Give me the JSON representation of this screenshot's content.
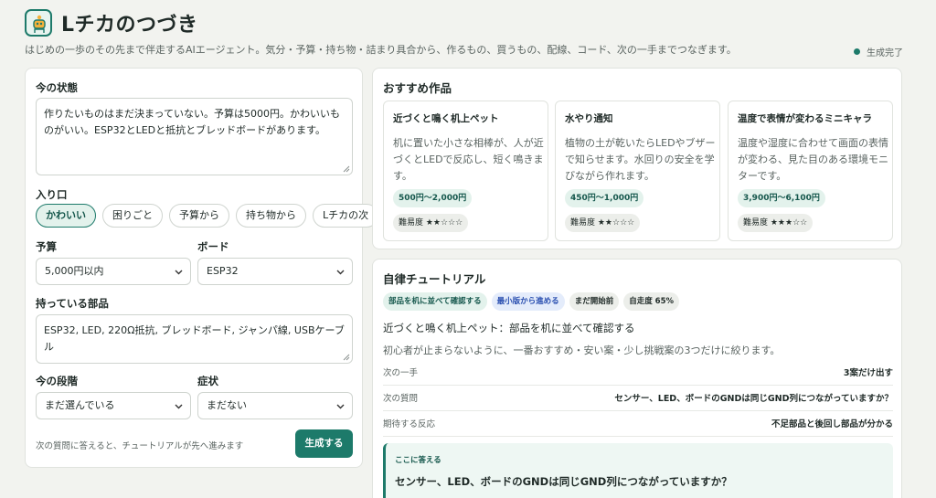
{
  "app": {
    "title": "Lチカのつづき",
    "subtitle": "はじめの一歩のその先まで伴走するAIエージェント。気分・予算・持ち物・詰まり具合から、作るもの、買うもの、配線、コード、次の一手までつなぎます。",
    "status": "生成完了",
    "accent": "#1d7a6a"
  },
  "form": {
    "state_label": "今の状態",
    "state_value": "作りたいものはまだ決まっていない。予算は5000円。かわいいものがいい。ESP32とLEDと抵抗とブレッドボードがあります。",
    "entry_label": "入り口",
    "entry_chips": [
      "かわいい",
      "困りごと",
      "予算から",
      "持ち物から",
      "Lチカの次"
    ],
    "entry_selected": "かわいい",
    "budget_label": "予算",
    "budget_value": "5,000円以内",
    "board_label": "ボード",
    "board_value": "ESP32",
    "parts_label": "持っている部品",
    "parts_value": "ESP32, LED, 220Ω抵抗, ブレッドボード, ジャンパ線, USBケーブル",
    "stage_label": "今の段階",
    "stage_value": "まだ選んでいる",
    "symptom_label": "症状",
    "symptom_value": "まだない",
    "hint": "次の質問に答えると、チュートリアルが先へ進みます",
    "generate_button": "生成する"
  },
  "recommend": {
    "title": "おすすめ作品",
    "cards": [
      {
        "title": "近づくと鳴く机上ペット",
        "desc": "机に置いた小さな相棒が、人が近づくとLEDで反応し、短く鳴きます。",
        "price": "500円〜2,000円",
        "difficulty": "難易度 ★★☆☆☆"
      },
      {
        "title": "水やり通知",
        "desc": "植物の土が乾いたらLEDやブザーで知らせます。水回りの安全を学びながら作れます。",
        "price": "450円〜1,000円",
        "difficulty": "難易度 ★★☆☆☆"
      },
      {
        "title": "温度で表情が変わるミニキャラ",
        "desc": "温度や湿度に合わせて画面の表情が変わる、見た目のある環境モニターです。",
        "price": "3,900円〜6,100円",
        "difficulty": "難易度 ★★★☆☆"
      }
    ]
  },
  "tutorial": {
    "title": "自律チュートリアル",
    "badges": [
      "部品を机に並べて確認する",
      "最小版から進める",
      "まだ開始前",
      "自走度 65%"
    ],
    "step_title": "近づくと鳴く机上ペット：部品を机に並べて確認する",
    "step_desc": "初心者が止まらないように、一番おすすめ・安い案・少し挑戦案の3つだけに絞ります。",
    "rows": [
      {
        "key": "次の一手",
        "value": "3案だけ出す"
      },
      {
        "key": "次の質問",
        "value": "センサー、LED、ボードのGNDは同じGND列につながっていますか？"
      },
      {
        "key": "期待する反応",
        "value": "不足部品と後回し部品が分かる"
      }
    ],
    "answer_label": "ここに答える",
    "answer_question": "センサー、LED、ボードのGNDは同じGND列につながっていますか？"
  }
}
